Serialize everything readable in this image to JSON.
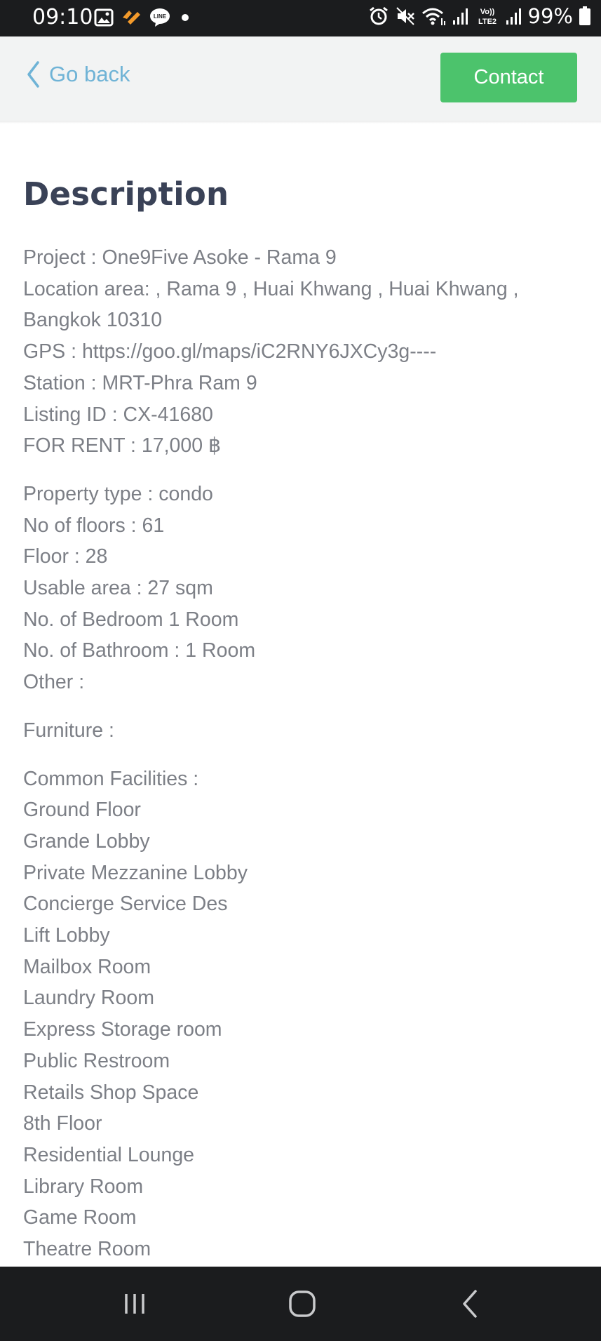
{
  "status_bar": {
    "time": "09:10",
    "battery_percent": "99%",
    "icons": [
      "gallery-icon",
      "notification-app-icon",
      "line-app-icon",
      "dot-icon",
      "alarm-icon",
      "mute-icon",
      "wifi-icon",
      "signal-icon",
      "volte-lte2-icon",
      "signal-icon",
      "battery-icon"
    ]
  },
  "header": {
    "back_label": "Go back",
    "contact_label": "Contact",
    "accent_color": "#4cc36c",
    "link_color": "#6fb3d6"
  },
  "description": {
    "title": "Description",
    "groups": [
      [
        "Project : One9Five Asoke - Rama 9",
        "Location area: , Rama 9 , Huai Khwang , Huai Khwang , Bangkok 10310",
        "GPS : https://goo.gl/maps/iC2RNY6JXCy3g----",
        "Station : MRT-Phra Ram 9",
        "Listing ID : CX-41680",
        "FOR RENT : 17,000 ฿"
      ],
      [
        "Property type : condo",
        "No of floors : 61",
        "Floor : 28",
        "Usable area : 27 sqm",
        "No. of Bedroom 1 Room",
        "No. of Bathroom : 1 Room",
        "Other :"
      ],
      [
        "Furniture :"
      ],
      [
        "Common Facilities :",
        "Ground Floor",
        "Grande Lobby",
        "Private Mezzanine Lobby",
        "Concierge Service Des",
        "Lift Lobby",
        "Mailbox Room",
        "Laundry Room",
        "Express Storage room",
        "Public Restroom",
        "Retails Shop Space",
        "8th Floor",
        "Residential Lounge",
        "Library Room",
        "Game Room",
        "Theatre Room"
      ]
    ]
  },
  "nav_bar": {
    "buttons": [
      "recent-apps-icon",
      "home-icon",
      "back-icon"
    ]
  }
}
